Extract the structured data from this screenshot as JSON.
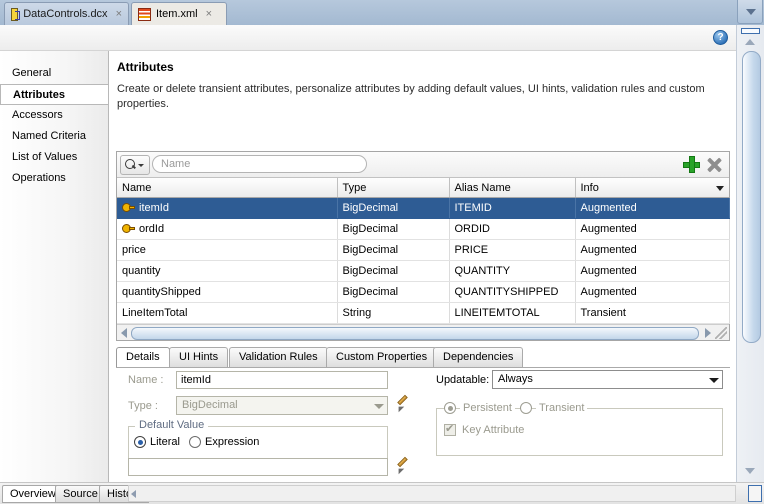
{
  "window": {
    "editor_tabs": [
      {
        "label": "DataControls.dcx",
        "icon": "dcx-icon",
        "close": "×",
        "active": false
      },
      {
        "label": "Item.xml",
        "icon": "xml-icon",
        "close": "×",
        "active": true
      }
    ],
    "help_icon": "?"
  },
  "sidebar": {
    "items": [
      {
        "label": "General",
        "selected": false
      },
      {
        "label": "Attributes",
        "selected": true
      },
      {
        "label": "Accessors",
        "selected": false
      },
      {
        "label": "Named Criteria",
        "selected": false
      },
      {
        "label": "List of Values",
        "selected": false
      },
      {
        "label": "Operations",
        "selected": false
      }
    ]
  },
  "section": {
    "title": "Attributes",
    "description": "Create or delete transient attributes, personalize attributes by adding default values, UI hints, validation rules and custom properties."
  },
  "toolbar": {
    "search_placeholder": "Name",
    "search_value": "",
    "add_label": "+",
    "delete_label": "×"
  },
  "table": {
    "columns": [
      "Name",
      "Type",
      "Alias Name",
      "Info"
    ],
    "rows": [
      {
        "name": "itemId",
        "type": "BigDecimal",
        "alias": "ITEMID",
        "info": "Augmented",
        "key": true,
        "selected": true
      },
      {
        "name": "ordId",
        "type": "BigDecimal",
        "alias": "ORDID",
        "info": "Augmented",
        "key": true,
        "selected": false
      },
      {
        "name": "price",
        "type": "BigDecimal",
        "alias": "PRICE",
        "info": "Augmented",
        "key": false,
        "selected": false
      },
      {
        "name": "quantity",
        "type": "BigDecimal",
        "alias": "QUANTITY",
        "info": "Augmented",
        "key": false,
        "selected": false
      },
      {
        "name": "quantityShipped",
        "type": "BigDecimal",
        "alias": "QUANTITYSHIPPED",
        "info": "Augmented",
        "key": false,
        "selected": false
      },
      {
        "name": "LineItemTotal",
        "type": "String",
        "alias": "LINEITEMTOTAL",
        "info": "Transient",
        "key": false,
        "selected": false
      }
    ]
  },
  "detail_tabs": [
    {
      "label": "Details",
      "active": true
    },
    {
      "label": "UI Hints",
      "active": false
    },
    {
      "label": "Validation Rules",
      "active": false
    },
    {
      "label": "Custom Properties",
      "active": false
    },
    {
      "label": "Dependencies",
      "active": false
    }
  ],
  "details_form": {
    "name_label": "Name :",
    "name_value": "itemId",
    "type_label": "Type :",
    "type_value": "BigDecimal",
    "updatable_label": "Updatable:",
    "updatable_value": "Always",
    "persistence": {
      "persistent_label": "Persistent",
      "transient_label": "Transient",
      "selected": "Persistent",
      "key_attribute_label": "Key Attribute",
      "key_attribute_checked": true
    },
    "default_value": {
      "legend": "Default Value",
      "literal_label": "Literal",
      "expression_label": "Expression",
      "selected": "Literal",
      "value": ""
    }
  },
  "bottom_tabs": [
    {
      "label": "Overview",
      "active": true
    },
    {
      "label": "Source",
      "active": false
    },
    {
      "label": "History",
      "active": false
    }
  ]
}
